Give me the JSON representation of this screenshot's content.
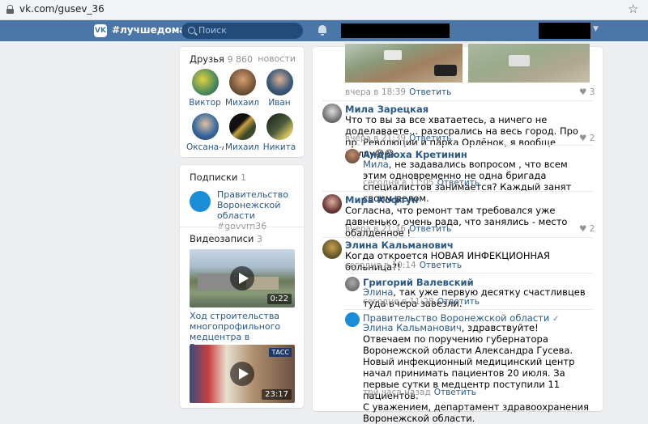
{
  "browser": {
    "url": "vk.com/gusev_36"
  },
  "header": {
    "hashtag": "#лучшедома",
    "search_placeholder": "Поиск",
    "logo_text": "VK"
  },
  "friends": {
    "title": "Друзья",
    "count": "9 860",
    "news": "новости",
    "items": [
      {
        "name": "Виктор",
        "color": "#4a8a5c"
      },
      {
        "name": "Михаил",
        "color": "#7a5a3c"
      },
      {
        "name": "Иван",
        "color": "#3c5a7a"
      },
      {
        "name": "Оксана-Ал...",
        "color": "#3a6aa0"
      },
      {
        "name": "Михаил",
        "color": "#3a4a2a"
      },
      {
        "name": "Никита",
        "color": "#2a3a2a"
      }
    ]
  },
  "subscriptions": {
    "title": "Подписки",
    "count": "1",
    "items": [
      {
        "name": "Правительство Воронежской области",
        "tag": "#govvrn36",
        "color": "#1a8cd8"
      }
    ]
  },
  "videos": {
    "title": "Видеозаписи",
    "count": "3",
    "items": [
      {
        "title": "Ход строительства многопрофильного медцентра в Воронеже",
        "duration": "0:22"
      },
      {
        "title": "",
        "duration": "23:17",
        "badge": "ТАСС"
      }
    ]
  },
  "post": {
    "meta": "вчера в 18:39",
    "reply": "Ответить",
    "likes": "3"
  },
  "comments": [
    {
      "author": "Мила Зарецкая",
      "text": "Что то вы за все хватаетесь, а ничего не доделаваете... разосрались на весь город. Про пр. Революции и парка Орлёнок, я вообще молчу😅😄",
      "meta": "вчера в 21:39",
      "likes": "2"
    },
    {
      "author": "Андрюха Кретинин",
      "mention": "Мила",
      "text": ", не задавались вопросом , что всем этим одновременно не одна бригада специалистов занимается? Каждый занят своим делом.",
      "meta": "сегодня в 11:05"
    },
    {
      "author": "Мира Кофтун",
      "text": "Согласна, что ремонт там требовался уже давненько, очень рада, что занялись - место обалденное !",
      "meta": "вчера в 21:16",
      "likes": "2"
    },
    {
      "author": "Элина Кальманович",
      "text": "Когда откроется НОВАЯ ИНФЕКЦИОННАЯ больница?!",
      "meta": "сегодня в 10:14"
    },
    {
      "author": "Григорий Валевский",
      "mention": "Элина",
      "text": ", так уже первую десятку счастливцев туда вчера завезли.",
      "meta": "сегодня в 11:28"
    },
    {
      "author": "Правительство Воронежской области",
      "mention": "Элина Кальманович",
      "text": ", здравствуйте!",
      "body": [
        "Отвечаем по поручению губернатора Воронежской области Александра Гусева.",
        "Новый инфекционный медицинский центр начал принимать пациентов 20 июля. За первые сутки в медцентр поступили 11 пациентов.",
        "С уважением, департамент здравоохранения Воронежской области."
      ],
      "meta": "три часа назад"
    }
  ],
  "reply_label": "Ответить",
  "icons": {
    "lock": "lock-icon",
    "star": "star-icon",
    "search": "search-icon",
    "bell": "bell-icon",
    "heart": "heart-icon",
    "play": "play-icon",
    "verified": "verified-icon"
  }
}
